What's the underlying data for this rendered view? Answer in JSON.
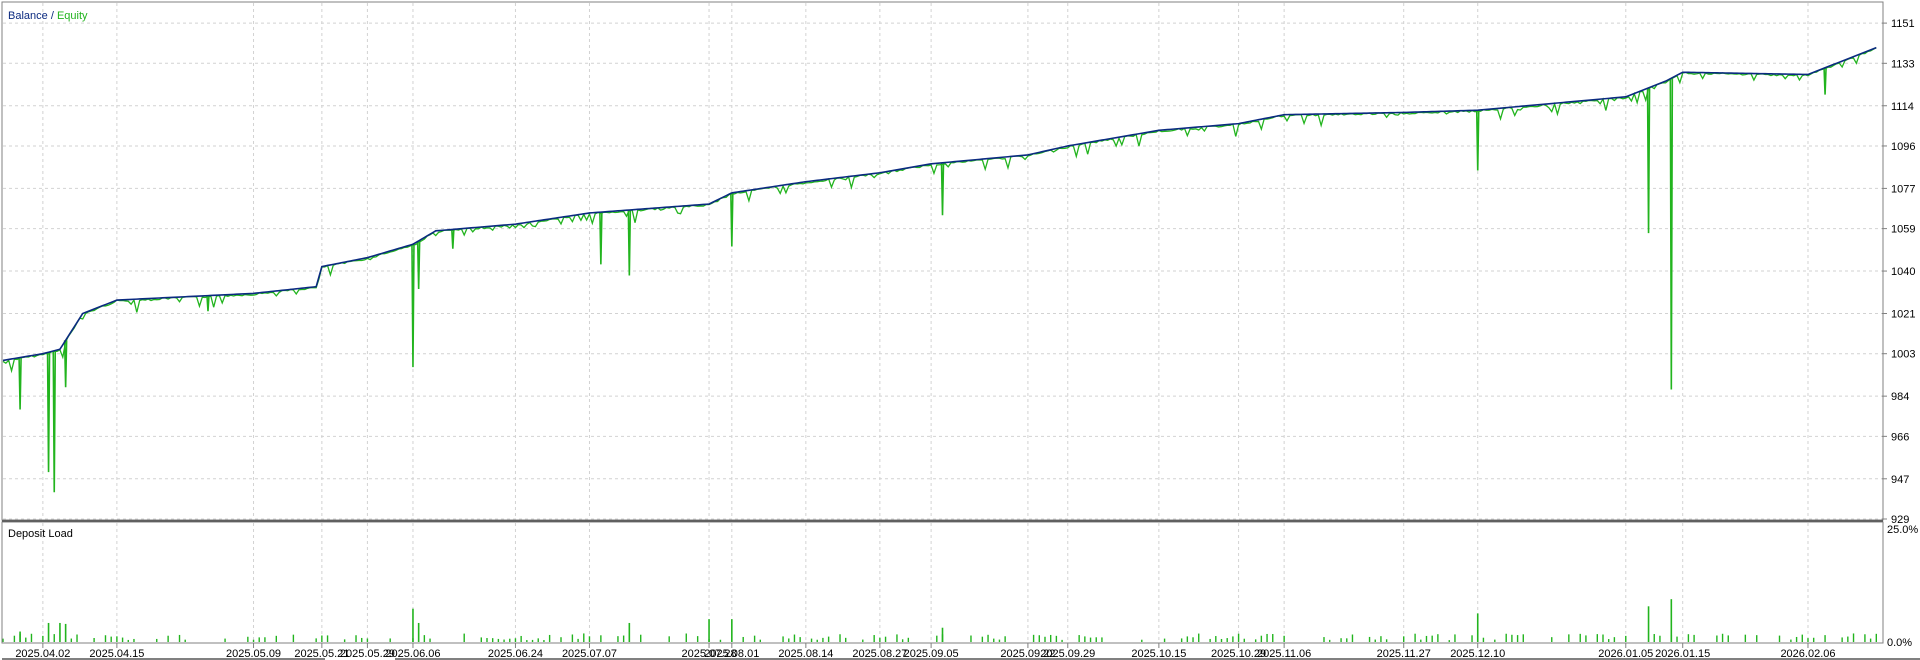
{
  "chart_data": [
    {
      "type": "line",
      "panel": "balance-equity",
      "legend_parts": [
        "Balance",
        " / ",
        "Equity"
      ],
      "series": [
        {
          "name": "Balance",
          "color": "#0b2a80"
        },
        {
          "name": "Equity",
          "color": "#22b41e"
        }
      ],
      "ylim": [
        929,
        1160
      ],
      "y_ticks": [
        "1151",
        "1133",
        "1114",
        "1096",
        "1077",
        "1059",
        "1040",
        "1021",
        "1003",
        "984",
        "966",
        "947",
        "929"
      ],
      "grid": true,
      "x_dates": [
        "2025-03-26",
        "2025-04-02",
        "2025-04-05",
        "2025-04-09",
        "2025-04-15",
        "2025-05-09",
        "2025-05-20",
        "2025-05-21",
        "2025-05-29",
        "2025-06-06",
        "2025-06-10",
        "2025-06-24",
        "2025-07-07",
        "2025-07-28",
        "2025-08-01",
        "2025-08-14",
        "2025-08-27",
        "2025-09-05",
        "2025-09-22",
        "2025-09-29",
        "2025-10-15",
        "2025-10-29",
        "2025-11-06",
        "2025-11-27",
        "2025-12-10",
        "2026-01-05",
        "2026-01-12",
        "2026-01-15",
        "2026-02-06",
        "2026-02-18"
      ],
      "balance": [
        1000,
        1003,
        1005,
        1021,
        1027,
        1030,
        1033,
        1042,
        1046,
        1052,
        1058,
        1061,
        1066,
        1070,
        1075,
        1080,
        1084,
        1088,
        1092,
        1096,
        1103,
        1106,
        1110,
        1111,
        1112,
        1118,
        1125,
        1129,
        1128,
        1140
      ],
      "equity_dips": [
        {
          "date": "2025-03-29",
          "value": 978
        },
        {
          "date": "2025-04-03",
          "value": 950
        },
        {
          "date": "2025-04-04",
          "value": 941
        },
        {
          "date": "2025-04-06",
          "value": 988
        },
        {
          "date": "2025-05-01",
          "value": 1022
        },
        {
          "date": "2025-06-06",
          "value": 997
        },
        {
          "date": "2025-06-07",
          "value": 1032
        },
        {
          "date": "2025-06-13",
          "value": 1050
        },
        {
          "date": "2025-07-09",
          "value": 1043
        },
        {
          "date": "2025-07-14",
          "value": 1038
        },
        {
          "date": "2025-08-01",
          "value": 1051
        },
        {
          "date": "2025-09-07",
          "value": 1065
        },
        {
          "date": "2025-12-10",
          "value": 1085
        },
        {
          "date": "2026-01-09",
          "value": 1057
        },
        {
          "date": "2026-01-13",
          "value": 987
        },
        {
          "date": "2026-02-09",
          "value": 1119
        }
      ]
    },
    {
      "type": "bar",
      "panel": "deposit-load",
      "title": "Deposit Load",
      "series": [
        {
          "color": "#22b41e"
        }
      ],
      "y_ticks": [
        "25.0%",
        "0.0%"
      ],
      "ylim": [
        0,
        25
      ],
      "spikes": [
        {
          "date": "2025-03-29",
          "value": 2.2
        },
        {
          "date": "2025-04-03",
          "value": 4.0
        },
        {
          "date": "2025-04-05",
          "value": 4.0
        },
        {
          "date": "2025-04-06",
          "value": 3.8
        },
        {
          "date": "2025-06-06",
          "value": 7.0
        },
        {
          "date": "2025-06-07",
          "value": 4.0
        },
        {
          "date": "2025-07-14",
          "value": 4.0
        },
        {
          "date": "2025-07-28",
          "value": 4.8
        },
        {
          "date": "2025-08-01",
          "value": 4.8
        },
        {
          "date": "2025-09-07",
          "value": 3.0
        },
        {
          "date": "2025-12-10",
          "value": 6.0
        },
        {
          "date": "2026-01-09",
          "value": 7.5
        },
        {
          "date": "2026-01-13",
          "value": 9.0
        }
      ]
    }
  ],
  "x_axis": {
    "tick_labels": [
      "2025.04.02",
      "2025.04.15",
      "2025.05.09",
      "2025.05.21",
      "2025.05.29",
      "2025.06.06",
      "2025.06.24",
      "2025.07.07",
      "2025.07.28",
      "2025.08.01",
      "2025.08.14",
      "2025.08.27",
      "2025.09.05",
      "2025.09.22",
      "2025.09.29",
      "2025.10.15",
      "2025.10.29",
      "2025.11.06",
      "2025.11.27",
      "2025.12.10",
      "2026.01.05",
      "2026.01.15",
      "2026.02.06"
    ]
  }
}
